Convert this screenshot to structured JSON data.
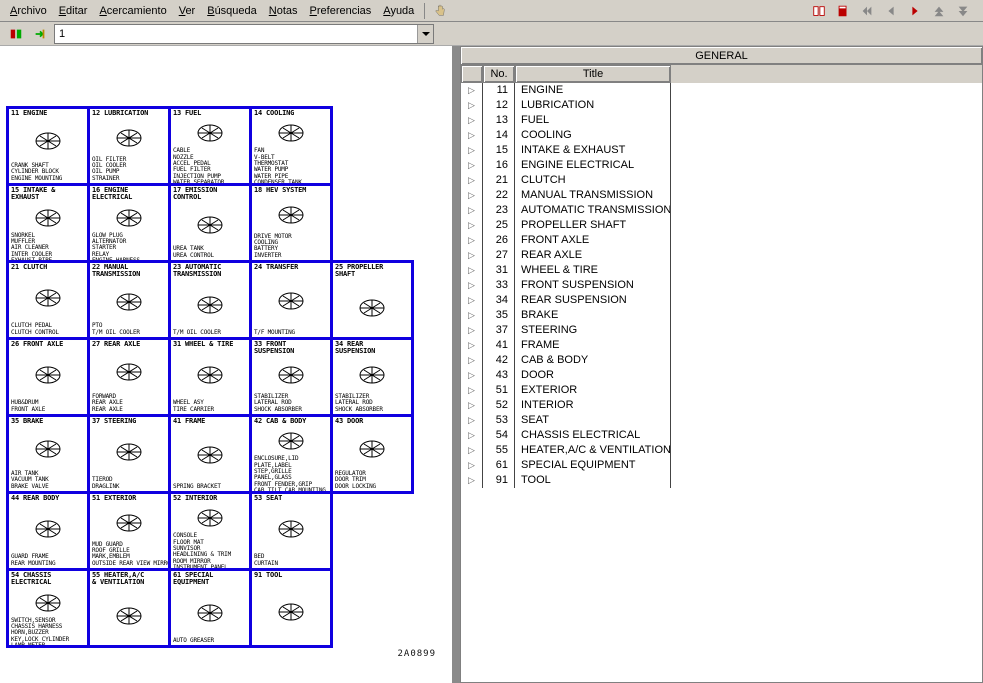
{
  "menu": {
    "items": [
      "Archivo",
      "Editar",
      "Acercamiento",
      "Ver",
      "Búsqueda",
      "Notas",
      "Preferencias",
      "Ayuda"
    ]
  },
  "address": {
    "value": "1"
  },
  "general": {
    "header": "GENERAL",
    "columns": {
      "expand": "",
      "no": "No.",
      "title": "Title"
    },
    "rows": [
      {
        "no": "11",
        "title": "ENGINE"
      },
      {
        "no": "12",
        "title": "LUBRICATION"
      },
      {
        "no": "13",
        "title": "FUEL"
      },
      {
        "no": "14",
        "title": "COOLING"
      },
      {
        "no": "15",
        "title": "INTAKE & EXHAUST"
      },
      {
        "no": "16",
        "title": "ENGINE ELECTRICAL"
      },
      {
        "no": "21",
        "title": "CLUTCH"
      },
      {
        "no": "22",
        "title": "MANUAL TRANSMISSION"
      },
      {
        "no": "23",
        "title": "AUTOMATIC TRANSMISSION"
      },
      {
        "no": "25",
        "title": "PROPELLER SHAFT"
      },
      {
        "no": "26",
        "title": "FRONT AXLE"
      },
      {
        "no": "27",
        "title": "REAR AXLE"
      },
      {
        "no": "31",
        "title": "WHEEL & TIRE"
      },
      {
        "no": "33",
        "title": "FRONT SUSPENSION"
      },
      {
        "no": "34",
        "title": "REAR SUSPENSION"
      },
      {
        "no": "35",
        "title": "BRAKE"
      },
      {
        "no": "37",
        "title": "STEERING"
      },
      {
        "no": "41",
        "title": "FRAME"
      },
      {
        "no": "42",
        "title": "CAB & BODY"
      },
      {
        "no": "43",
        "title": "DOOR"
      },
      {
        "no": "51",
        "title": "EXTERIOR"
      },
      {
        "no": "52",
        "title": "INTERIOR"
      },
      {
        "no": "53",
        "title": "SEAT"
      },
      {
        "no": "54",
        "title": "CHASSIS ELECTRICAL"
      },
      {
        "no": "55",
        "title": "HEATER,A/C & VENTILATION"
      },
      {
        "no": "61",
        "title": "SPECIAL EQUIPMENT"
      },
      {
        "no": "91",
        "title": "TOOL"
      }
    ]
  },
  "catalog": {
    "rows": [
      [
        {
          "hd": "11 ENGINE",
          "ft": "CRANK SHAFT\nCYLINDER BLOCK\nENGINE MOUNTING"
        },
        {
          "hd": "12 LUBRICATION",
          "ft": "OIL FILTER\nOIL COOLER\nOIL PUMP\nSTRAINER"
        },
        {
          "hd": "13 FUEL",
          "ft": "CABLE\nNOZZLE\nACCEL PEDAL\nFUEL FILTER\nINJECTION PUMP\nWATER SEPARATOR"
        },
        {
          "hd": "14 COOLING",
          "ft": "FAN\nV-BELT\nTHERMOSTAT\nWATER PUMP\nWATER PIPE\nCONDENSER TANK"
        }
      ],
      [
        {
          "hd": "15 INTAKE &\nEXHAUST",
          "ft": "SNORKEL\nMUFFLER\nAIR CLEANER\nINTER COOLER\nEXHAUST PIPE\nEXHAUST BRAKE"
        },
        {
          "hd": "16 ENGINE\nELECTRICAL",
          "ft": "GLOW PLUG\nALTERNATOR\nSTARTER\nRELAY\nENGINE HARNESS\nAIR INTAKE HEATER"
        },
        {
          "hd": "17 EMISSION\nCONTROL",
          "ft": "UREA TANK\nUREA CONTROL"
        },
        {
          "hd": "18 HEV SYSTEM",
          "ft": "DRIVE MOTOR\nCOOLING\nBATTERY\nINVERTER"
        }
      ],
      [
        {
          "hd": "21 CLUTCH",
          "ft": "CLUTCH PEDAL\nCLUTCH CONTROL"
        },
        {
          "hd": "22 MANUAL\nTRANSMISSION",
          "ft": "PTO\nT/M OIL COOLER"
        },
        {
          "hd": "23 AUTOMATIC\nTRANSMISSION",
          "ft": "T/M OIL COOLER"
        },
        {
          "hd": "24 TRANSFER",
          "ft": "T/F MOUNTING"
        },
        {
          "hd": "25 PROPELLER\nSHAFT",
          "ft": ""
        }
      ],
      [
        {
          "hd": "26 FRONT AXLE",
          "ft": "HUB&DRUM\nFRONT AXLE"
        },
        {
          "hd": "27 REAR AXLE",
          "ft": "FORWARD\nREAR AXLE\nREAR AXLE"
        },
        {
          "hd": "31 WHEEL & TIRE",
          "ft": "WHEEL ASY\nTIRE CARRIER"
        },
        {
          "hd": "33 FRONT\nSUSPENSION",
          "ft": "STABILIZER\nLATERAL ROD\nSHOCK ABSORBER"
        },
        {
          "hd": "34 REAR\nSUSPENSION",
          "ft": "STABILIZER\nLATERAL ROD\nSHOCK ABSORBER"
        }
      ],
      [
        {
          "hd": "35 BRAKE",
          "ft": "AIR TANK\nVACUUM TANK\nBRAKE VALVE"
        },
        {
          "hd": "37 STEERING",
          "ft": "TIEROD\nDRAGLINK"
        },
        {
          "hd": "41 FRAME",
          "ft": "SPRING BRACKET"
        },
        {
          "hd": "42 CAB & BODY",
          "ft": "ENCLOSURE,LID\nPLATE,LABEL\nSTEP,GRILLE\nPANEL,GLASS\nFRONT FENDER,GRIP\nCAB TILT,CAB MOUNTING"
        },
        {
          "hd": "43 DOOR",
          "ft": "REGULATOR\nDOOR TRIM\nDOOR LOCKING"
        }
      ],
      [
        {
          "hd": "44 REAR BODY",
          "ft": "GUARD FRAME\nREAR MOUNTING"
        },
        {
          "hd": "51 EXTERIOR",
          "ft": "MUD GUARD\nROOF GRILLE\nMARK,EMBLEM\nOUTSIDE REAR VIEW MIRROR"
        },
        {
          "hd": "52 INTERIOR",
          "ft": "CONSOLE\nFLOOR MAT\nSUNVISOR\nHEADLINING & TRIM\nROOM MIRROR\nINSTRUMENT PANEL"
        },
        {
          "hd": "53 SEAT",
          "ft": "BED\nCURTAIN"
        }
      ],
      [
        {
          "hd": "54 CHASSIS\nELECTRICAL",
          "ft": "SWITCH,SENSOR\nCHASSIS HARNESS\nHORN,BUZZER\nKEY,LOCK CYLINDER\nLAMP,METER"
        },
        {
          "hd": "55 HEATER,A/C\n& VENTILATION",
          "ft": ""
        },
        {
          "hd": "61 SPECIAL\nEQUIPMENT",
          "ft": "AUTO GREASER"
        },
        {
          "hd": "91 TOOL",
          "ft": ""
        }
      ]
    ],
    "watermark": "2A0899"
  }
}
